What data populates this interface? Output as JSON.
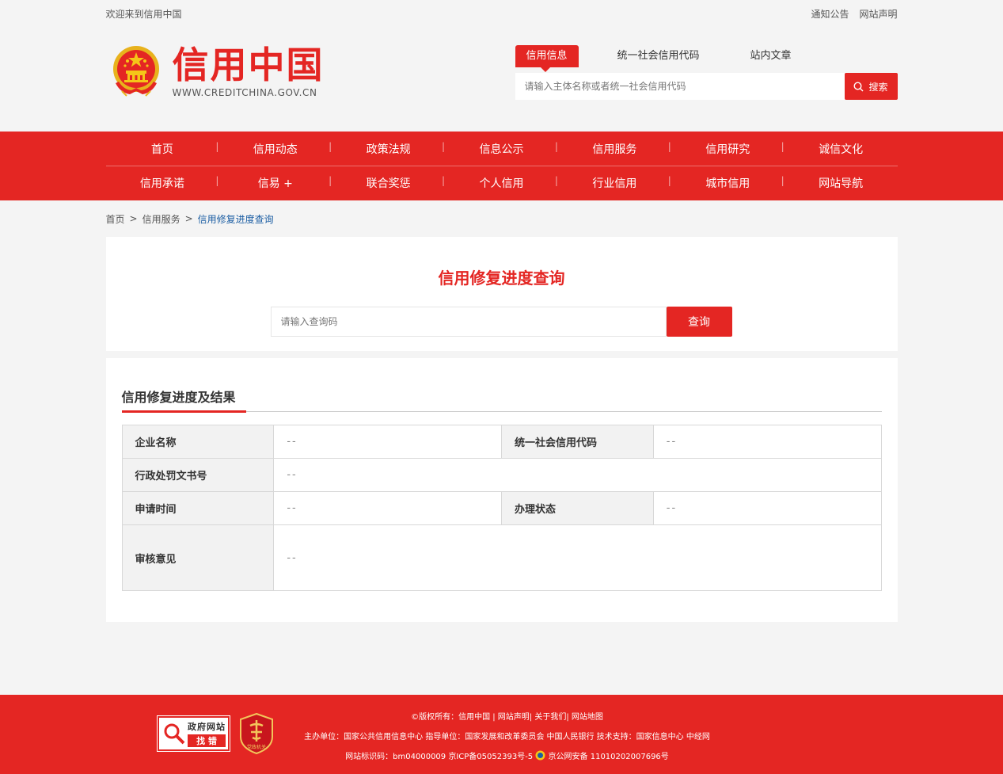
{
  "topbar": {
    "welcome": "欢迎来到信用中国",
    "links": [
      "通知公告",
      "网站声明"
    ]
  },
  "logo": {
    "title": "信用中国",
    "url": "WWW.CREDITCHINA.GOV.CN"
  },
  "search": {
    "tabs": [
      "信用信息",
      "统一社会信用代码",
      "站内文章"
    ],
    "placeholder": "请输入主体名称或者统一社会信用代码",
    "button": "搜索"
  },
  "nav": {
    "row1": [
      "首页",
      "信用动态",
      "政策法规",
      "信息公示",
      "信用服务",
      "信用研究",
      "诚信文化"
    ],
    "row2": [
      "信用承诺",
      "信易 +",
      "联合奖惩",
      "个人信用",
      "行业信用",
      "城市信用",
      "网站导航"
    ]
  },
  "breadcrumb": {
    "items": [
      "首页",
      "信用服务",
      "信用修复进度查询"
    ],
    "separator": ">"
  },
  "query": {
    "title": "信用修复进度查询",
    "placeholder": "请输入查询码",
    "button": "查询"
  },
  "result": {
    "title": "信用修复进度及结果",
    "rows": {
      "company_label": "企业名称",
      "company_value": "--",
      "code_label": "统一社会信用代码",
      "code_value": "--",
      "doc_label": "行政处罚文书号",
      "doc_value": "--",
      "date_label": "申请时间",
      "date_value": "--",
      "status_label": "办理状态",
      "status_value": "--",
      "opinion_label": "审核意见",
      "opinion_value": "--"
    }
  },
  "footer": {
    "badge1_top": "政府网站",
    "badge1_bottom": "找 错",
    "badge2": "党政机关",
    "line1": "©版权所有：信用中国 | 网站声明| 关于我们| 网站地图",
    "line2": "主办单位：国家公共信用信息中心   指导单位：国家发展和改革委员会 中国人民银行   技术支持：国家信息中心 中经网",
    "line3_a": "网站标识码：bm04000009 京ICP备05052393号-5",
    "line3_b": "京公网安备 11010202007696号"
  },
  "colors": {
    "brand_red": "#e42623",
    "link_blue": "#1c5ea3"
  }
}
